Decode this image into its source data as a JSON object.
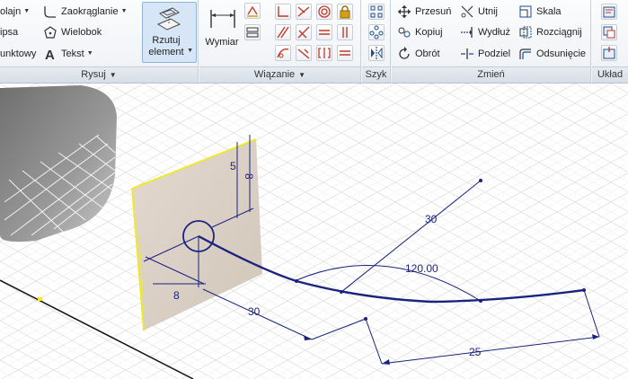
{
  "ribbon": {
    "rysuj": {
      "title": "Rysuj",
      "items": {
        "polyline": "olajn",
        "ellipse": "ipsa",
        "points": "unktowy",
        "fillet": "Zaokrąglanie",
        "polygon": "Wielobok",
        "text": "Tekst",
        "project": "Rzutuj element"
      }
    },
    "wiazanie": {
      "title": "Wiązanie",
      "dimension": "Wymiar"
    },
    "szyk": {
      "title": "Szyk"
    },
    "zmien": {
      "title": "Zmień",
      "items": {
        "move": "Przesuń",
        "trim": "Utnij",
        "scale": "Skala",
        "copy": "Kopiuj",
        "extend": "Wydłuż",
        "stretch": "Rozciągnij",
        "rotate": "Obrót",
        "split": "Podziel",
        "offset": "Odsunięcie"
      }
    },
    "uklad": {
      "title": "Układ"
    }
  },
  "sketch": {
    "dimensions": {
      "d_5": "5",
      "d_8_vertical": "8",
      "d_8_horizontal": "8",
      "d_30_upper": "30",
      "d_30_lower": "30",
      "angle": "120.00",
      "d_25": "25"
    }
  },
  "colors": {
    "ribbon_bg": "#eef1f5",
    "active_button": "#d6e6f7",
    "sketch_line": "#1a237e",
    "plane_fill": "#d9cfc5",
    "plane_edge": "#f0ea20"
  }
}
